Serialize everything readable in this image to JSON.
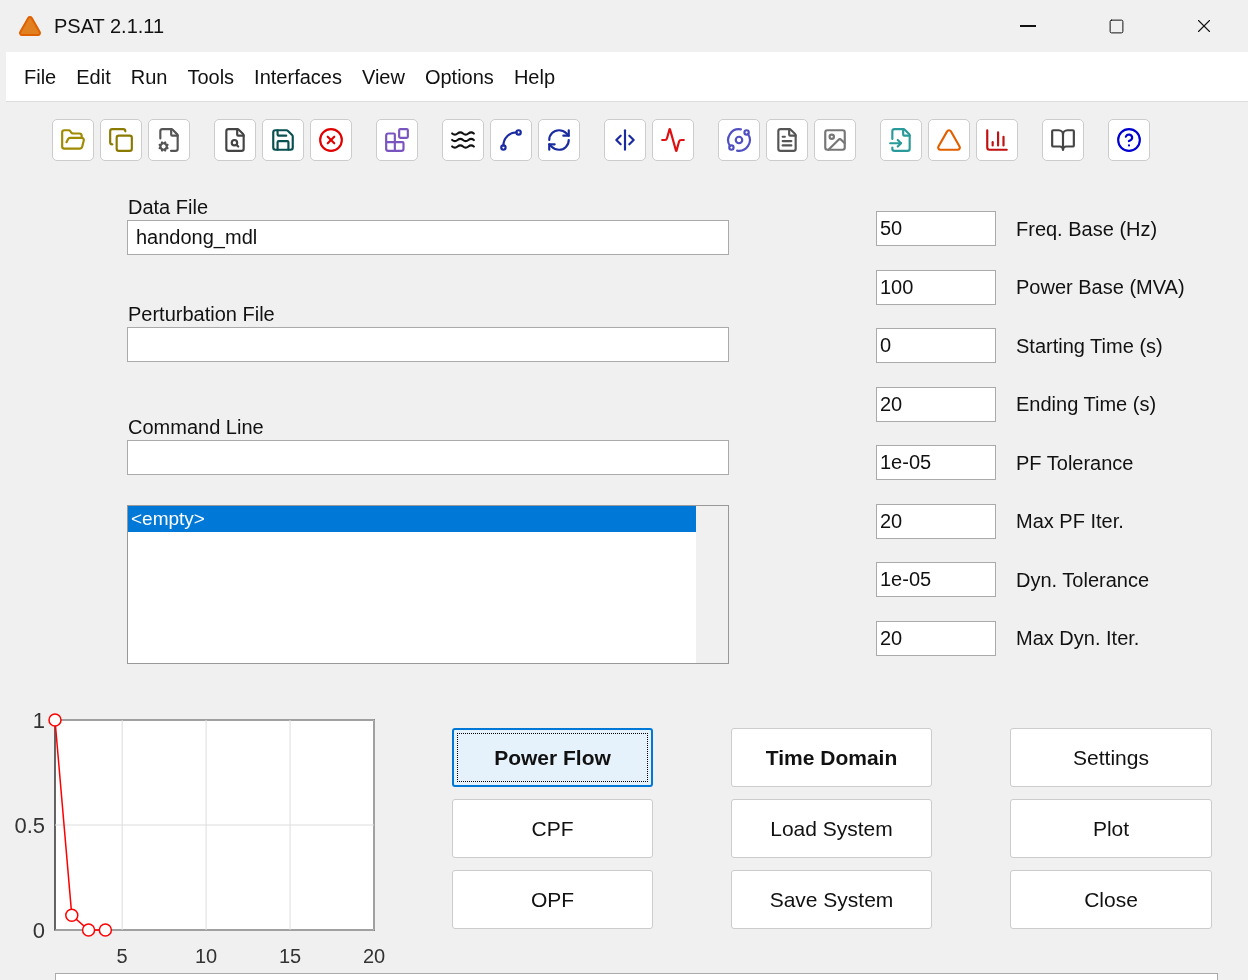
{
  "window": {
    "title": "PSAT 2.1.11"
  },
  "menu": [
    "File",
    "Edit",
    "Run",
    "Tools",
    "Interfaces",
    "View",
    "Options",
    "Help"
  ],
  "files": [
    {
      "label": "Data File",
      "value": "handong_mdl"
    },
    {
      "label": "Perturbation File"
    },
    {
      "label": "Command Line"
    }
  ],
  "list": [
    {
      "text": "<empty>",
      "selected": true
    }
  ],
  "settings": [
    {
      "value": "50",
      "label": "Freq. Base (Hz)"
    },
    {
      "value": "100",
      "label": "Power Base (MVA)"
    },
    {
      "value": "0",
      "label": "Starting Time (s)"
    },
    {
      "value": "20",
      "label": "Ending Time (s)"
    },
    {
      "value": "1e-05",
      "label": "PF Tolerance"
    },
    {
      "value": "20",
      "label": "Max PF Iter."
    },
    {
      "value": "1e-05",
      "label": "Dyn. Tolerance"
    },
    {
      "value": "20",
      "label": "Max Dyn. Iter."
    }
  ],
  "chart": {
    "chart_data": {
      "type": "line",
      "x": [
        1,
        2,
        3,
        4
      ],
      "grid": true,
      "series": [
        {
          "color": "#ff0000",
          "marker": "o",
          "values": [
            1,
            0.07,
            0,
            0
          ]
        }
      ],
      "xlim": [
        1,
        20
      ],
      "ylim": [
        0,
        1
      ],
      "xticks": [
        5,
        10,
        15,
        20
      ],
      "yticks": [
        0,
        0.5,
        1
      ]
    }
  },
  "buttons": [
    {
      "label": "Power Flow",
      "bold": true,
      "focused": true
    },
    {
      "label": "Time Domain",
      "bold": true,
      "focused": false
    },
    {
      "label": "Settings",
      "bold": false,
      "focused": false
    },
    {
      "label": "CPF",
      "bold": false,
      "focused": false
    },
    {
      "label": "Load System",
      "bold": false,
      "focused": false
    },
    {
      "label": "Plot",
      "bold": false,
      "focused": false
    },
    {
      "label": "OPF",
      "bold": false,
      "focused": false
    },
    {
      "label": "Save System",
      "bold": false,
      "focused": false
    },
    {
      "label": "Close",
      "bold": false,
      "focused": false
    }
  ]
}
